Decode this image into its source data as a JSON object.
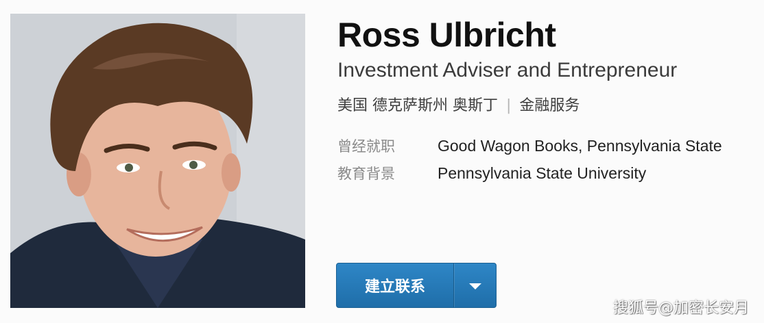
{
  "profile": {
    "name": "Ross Ulbricht",
    "headline": "Investment Adviser and Entrepreneur",
    "location": "美国 德克萨斯州 奥斯丁",
    "industry": "金融服务",
    "separator": "|",
    "previous_label": "曾经就职",
    "previous_value": "Good Wagon Books, Pennsylvania State",
    "education_label": "教育背景",
    "education_value": "Pennsylvania State University"
  },
  "actions": {
    "connect_label": "建立联系",
    "dropdown_icon": "caret-down-icon"
  },
  "watermark": {
    "text": "搜狐号@加密长安月"
  },
  "colors": {
    "button": "#2277b8",
    "name": "#111111",
    "label": "#8a8a8a"
  }
}
